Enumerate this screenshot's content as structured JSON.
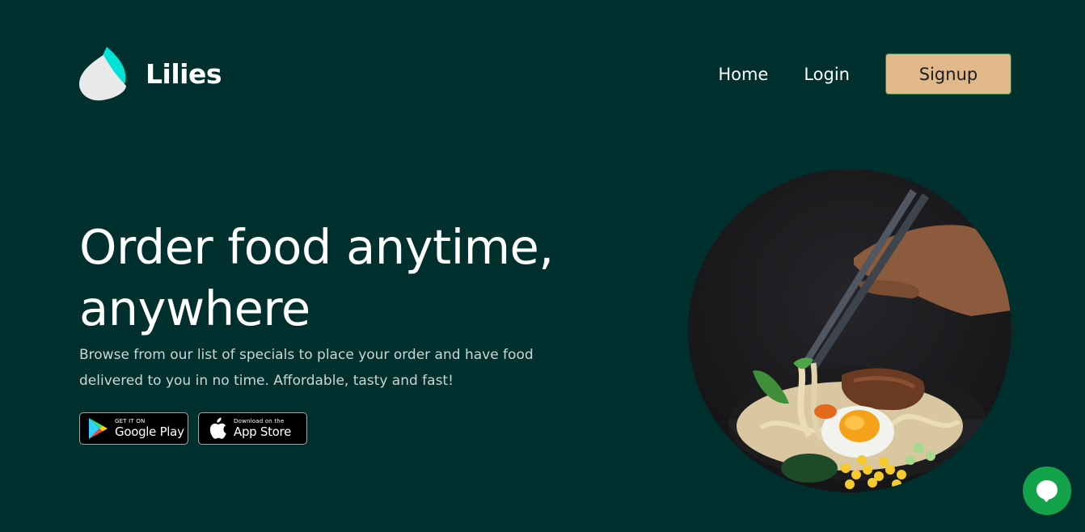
{
  "brand": {
    "name": "Lilies"
  },
  "nav": {
    "home": "Home",
    "login": "Login",
    "signup": "Signup"
  },
  "hero": {
    "title": "Order food anytime, anywhere",
    "subtitle": "Browse from our list of specials to place your order and have food delivered to you in no time. Affordable, tasty and fast!"
  },
  "stores": {
    "google": {
      "small": "GET IT ON",
      "big": "Google Play"
    },
    "apple": {
      "small": "Download on the",
      "big": "App Store"
    }
  },
  "colors": {
    "background": "#00302e",
    "signup_button": "#e0b88a",
    "chat_button": "#14a34a",
    "logo_accent": "#00e2d5"
  },
  "icons": {
    "logo": "leaf-drop-icon",
    "google_play": "google-play-icon",
    "apple": "apple-icon",
    "chat": "chat-bubble-icon"
  }
}
